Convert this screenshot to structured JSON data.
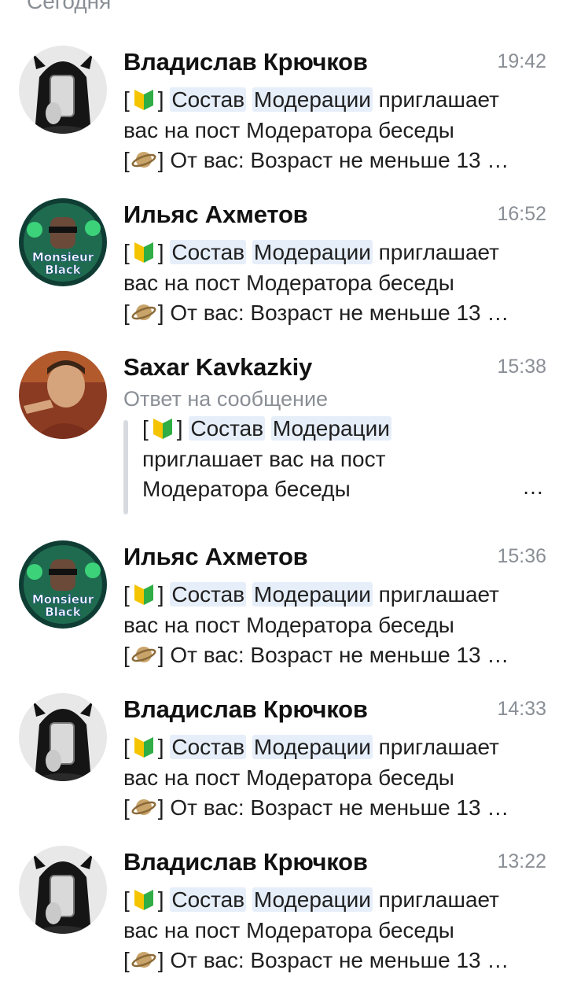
{
  "section_header": "Сегодня",
  "common": {
    "bracket_open": "[",
    "bracket_close": "]",
    "badge_emoji": "japanese-beginner-symbol",
    "planet_emoji": "ringed-planet",
    "word_sostav": "Состав",
    "word_moderatsii": "Модерации",
    "tail1": "приглашает",
    "line2": "вас на пост Модератора беседы",
    "line3": "От вас: Возраст не меньше 13 …"
  },
  "messages": [
    {
      "name": "Владислав Крючков",
      "time": "19:42",
      "avatar": "girl-phone-selfie"
    },
    {
      "name": "Ильяс Ахметов",
      "time": "16:52",
      "avatar": "monsieur-black"
    },
    {
      "name": "Saxar Kavkazkiy",
      "time": "15:38",
      "avatar": "man-pointing",
      "reply_label": "Ответ на сообщение",
      "quote_line2": "приглашает вас на пост",
      "quote_line3": "Модератора беседы",
      "quote_more": "…"
    },
    {
      "name": "Ильяс Ахметов",
      "time": "15:36",
      "avatar": "monsieur-black"
    },
    {
      "name": "Владислав Крючков",
      "time": "14:33",
      "avatar": "girl-phone-selfie"
    },
    {
      "name": "Владислав Крючков",
      "time": "13:22",
      "avatar": "girl-phone-selfie"
    }
  ],
  "avatar_text": {
    "line1": "Monsieur",
    "line2": "Black"
  },
  "colors": {
    "highlight": "#e6eef9",
    "muted": "#8a8f96",
    "quote_bar": "#d7dbe0"
  }
}
